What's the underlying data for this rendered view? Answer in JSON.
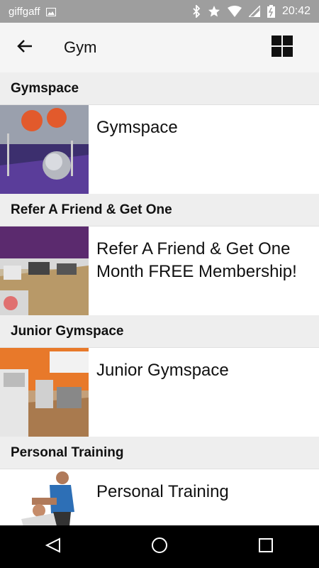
{
  "status_bar": {
    "carrier": "giffgaff",
    "time": "20:42",
    "icons": [
      "image-icon",
      "bluetooth-icon",
      "star-icon",
      "wifi-icon",
      "signal-icon",
      "battery-icon"
    ]
  },
  "app_bar": {
    "title": "Gym",
    "back_icon": "arrow-left-icon",
    "grid_icon": "grid-view-icon"
  },
  "sections": [
    {
      "header": "Gymspace",
      "item_title": "Gymspace"
    },
    {
      "header": "Refer A Friend & Get One",
      "item_title": "Refer A Friend & Get One Month FREE Membership!"
    },
    {
      "header": "Junior Gymspace",
      "item_title": "Junior Gymspace"
    },
    {
      "header": "Personal Training",
      "item_title": "Personal Training"
    }
  ],
  "nav_bar": {
    "icons": [
      "back-triangle-icon",
      "home-circle-icon",
      "recents-square-icon"
    ]
  },
  "colors": {
    "status_bar": "#9e9e9e",
    "app_bar": "#f5f5f5",
    "section_header": "#eeeeee",
    "nav_bar": "#000000"
  }
}
